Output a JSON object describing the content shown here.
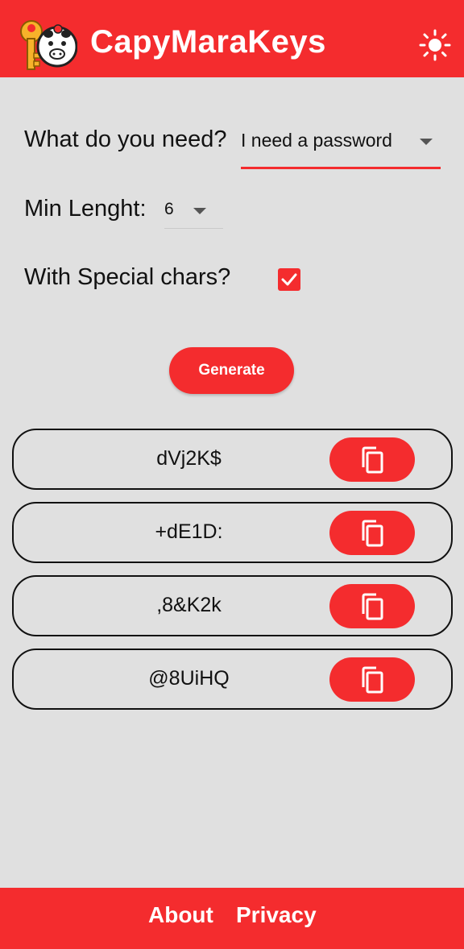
{
  "app": {
    "title": "CapyMaraKeys",
    "accent_color": "#f42c2e",
    "background_color": "#e0e0e0",
    "theme_icon": "sun-icon",
    "logo_icon": "capybara-key-logo"
  },
  "form": {
    "need_label": "What do you need?",
    "need_value": "I need a password",
    "min_length_label": "Min Lenght:",
    "min_length_value": "6",
    "special_chars_label": "With Special chars?",
    "special_chars_checked": true
  },
  "generate_label": "Generate",
  "results": [
    {
      "password": "dVj2K$"
    },
    {
      "password": "+dE1D:"
    },
    {
      "password": ",8&K2k"
    },
    {
      "password": "@8UiHQ"
    }
  ],
  "copy_icon": "copy-icon",
  "footer": {
    "about_label": "About",
    "privacy_label": "Privacy"
  }
}
